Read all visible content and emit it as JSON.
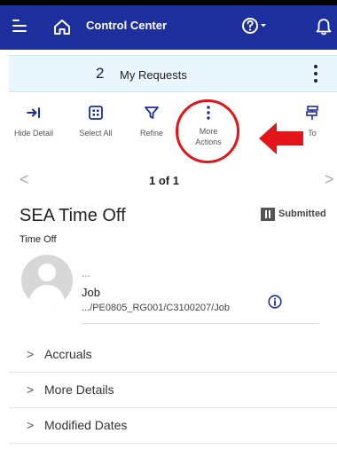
{
  "app": {
    "title": "Control Center"
  },
  "requests": {
    "count": "2",
    "label": "My Requests"
  },
  "toolbar": {
    "hide_detail": "Hide Detail",
    "select_all": "Select All",
    "refine": "Refine",
    "more_actions": "More Actions",
    "go_to": "To"
  },
  "pager": {
    "text": "1 of 1",
    "prev": "<",
    "next": ">"
  },
  "request": {
    "title": "SEA Time Off",
    "status": "Submitted",
    "type": "Time Off",
    "person_name": "---",
    "job_label": "Job",
    "job_path": ".../PE0805_RG001/C3100207/Job"
  },
  "sections": [
    {
      "label": "Accruals"
    },
    {
      "label": "More Details"
    },
    {
      "label": "Modified Dates"
    }
  ],
  "colors": {
    "header": "#1d2f9c",
    "highlight": "#e3141a",
    "accent": "#1d2f9c"
  }
}
